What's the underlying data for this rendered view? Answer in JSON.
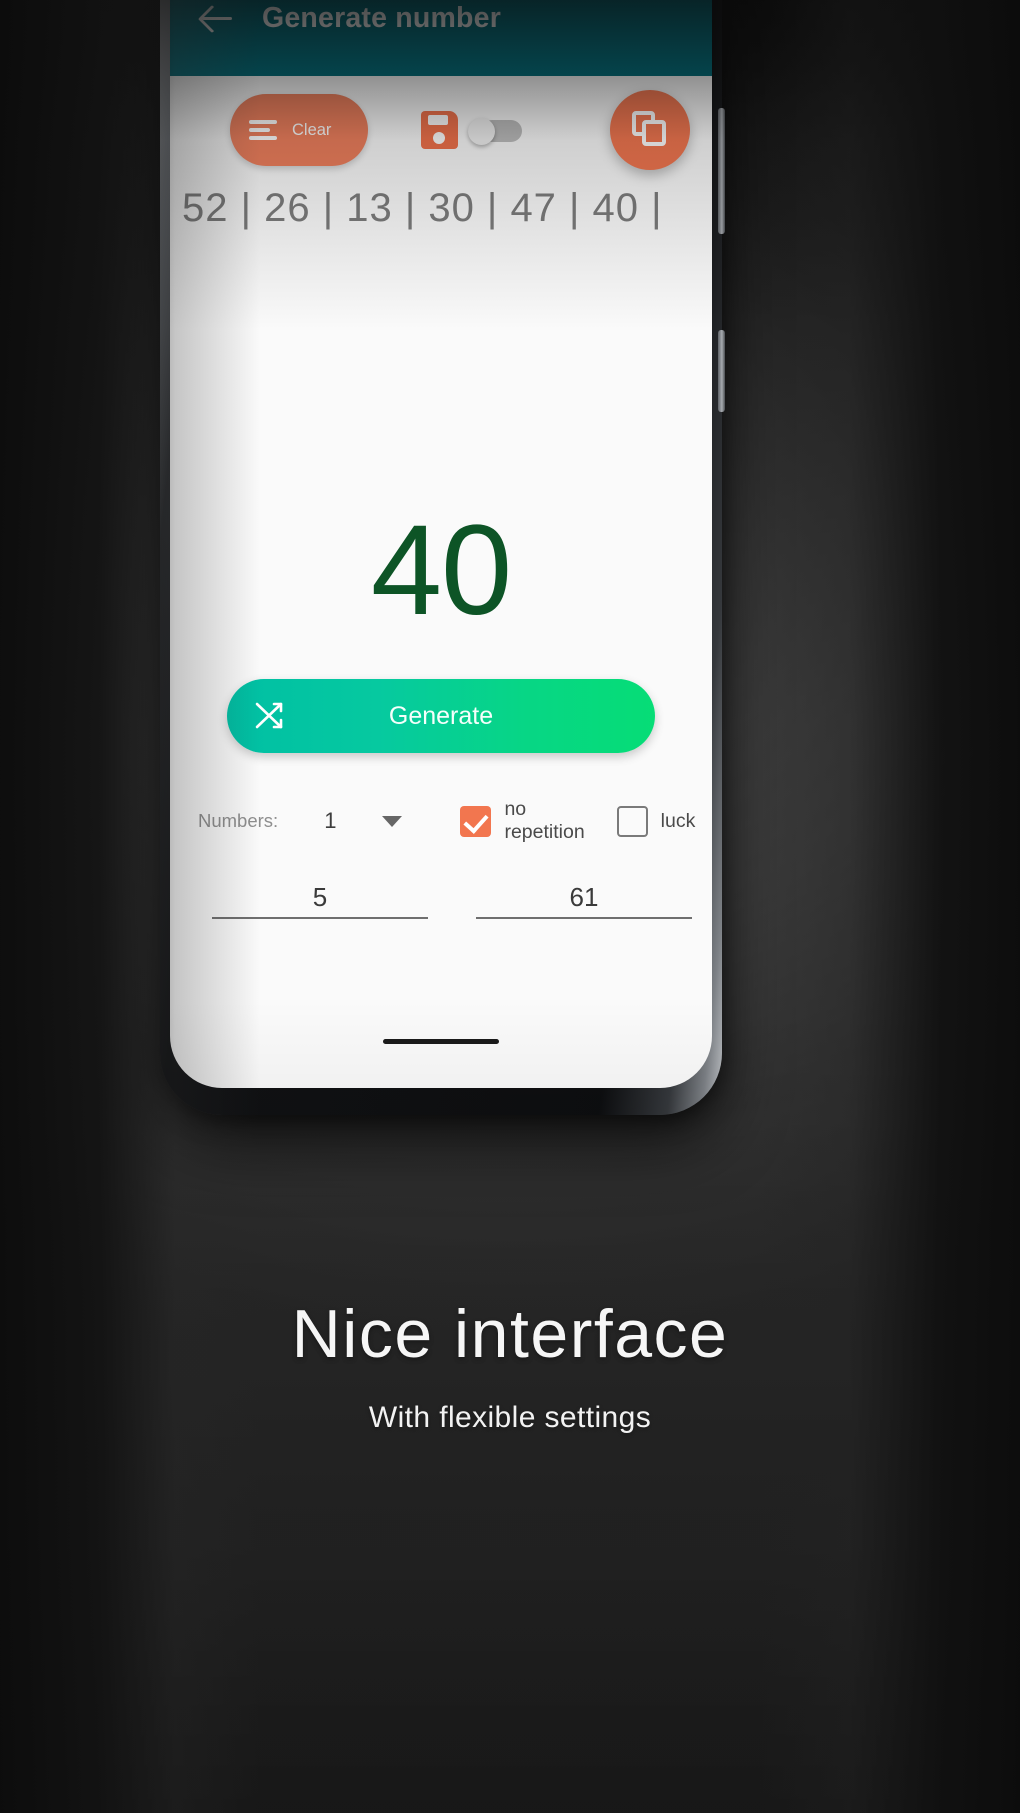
{
  "appbar": {
    "back_icon": "back-arrow-icon",
    "title": "Generate number"
  },
  "toolbar": {
    "clear_label": "Clear",
    "clear_icon": "list-lines-icon",
    "save_icon": "floppy-save-icon",
    "save_toggle_state": "off",
    "copy_icon": "copy-icon"
  },
  "history": {
    "text": "52 | 26 | 13 | 30 | 47 | 40 |",
    "values": [
      52,
      26,
      13,
      30,
      47,
      40
    ]
  },
  "result": {
    "value": "40",
    "color": "#0d5426"
  },
  "generate": {
    "label": "Generate",
    "icon": "shuffle-icon",
    "gradient_from": "#00bfa4",
    "gradient_to": "#06dd76"
  },
  "options": {
    "numbers_label": "Numbers:",
    "numbers_value": "1",
    "caret_icon": "chevron-down-icon",
    "no_repetition_label": "no repetition",
    "no_repetition_checked": "checked",
    "luck_label": "luck",
    "luck_checked": "unchecked",
    "accent": "#f2764f"
  },
  "ranges": {
    "min_value": "5",
    "max_value": "61"
  },
  "caption": {
    "title": "Nice interface",
    "subtitle": "With flexible settings"
  }
}
